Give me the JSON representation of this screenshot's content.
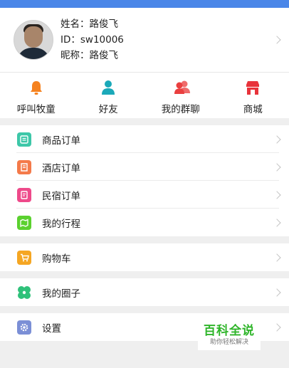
{
  "profile": {
    "name_line": "姓名：路俊飞",
    "id_line": "ID：sw10006",
    "nick_line": "昵称：路俊飞"
  },
  "quick_actions": [
    {
      "label": "呼叫牧童",
      "icon": "bell-icon",
      "color": "#f5821f"
    },
    {
      "label": "好友",
      "icon": "person-icon",
      "color": "#1ba9b9"
    },
    {
      "label": "我的群聊",
      "icon": "group-icon",
      "color": "#ef4e4e"
    },
    {
      "label": "商城",
      "icon": "store-icon",
      "color": "#e8333b"
    }
  ],
  "menu_groups": [
    {
      "items": [
        {
          "label": "商品订单",
          "icon": "document-icon",
          "color": "#3dc7a8"
        },
        {
          "label": "酒店订单",
          "icon": "receipt-icon",
          "color": "#f47a4a"
        },
        {
          "label": "民宿订单",
          "icon": "clipboard-icon",
          "color": "#ee4a8a"
        },
        {
          "label": "我的行程",
          "icon": "map-icon",
          "color": "#5bd12f"
        }
      ]
    },
    {
      "items": [
        {
          "label": "购物车",
          "icon": "cart-icon",
          "color": "#f5a623"
        }
      ]
    },
    {
      "items": [
        {
          "label": "我的圈子",
          "icon": "clover-icon",
          "color": "#2fc17a"
        }
      ]
    },
    {
      "items": [
        {
          "label": "设置",
          "icon": "gear-icon",
          "color": "#7b8fd6"
        }
      ]
    }
  ],
  "watermark": {
    "title": "百科全说",
    "subtitle": "助你轻松解决"
  }
}
